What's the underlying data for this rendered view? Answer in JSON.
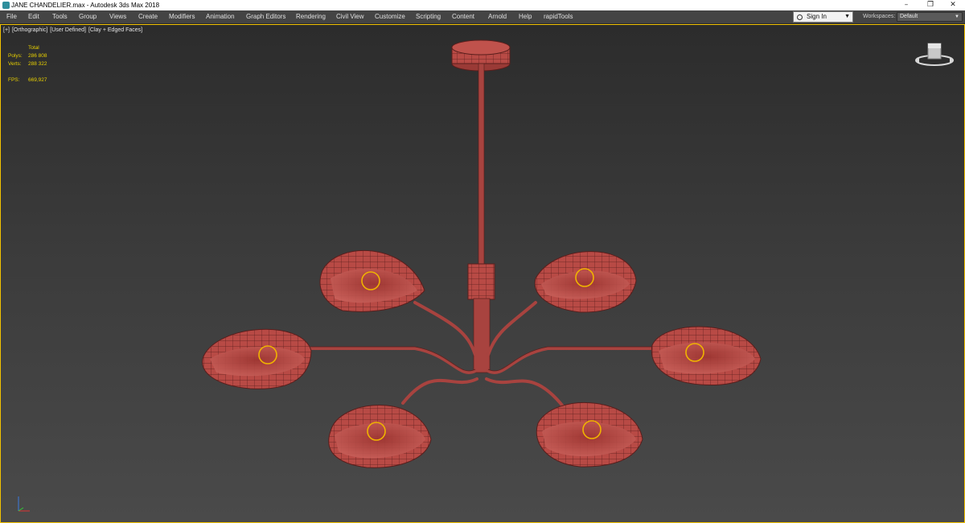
{
  "titlebar": {
    "title": "JANE CHANDELIER.max - Autodesk 3ds Max 2018",
    "app_icon": "3ds-max-icon",
    "controls": {
      "minimize": "–",
      "restore": "❐",
      "close": "✕"
    }
  },
  "menu": {
    "items": [
      "File",
      "Edit",
      "Tools",
      "Group",
      "Views",
      "Create",
      "Modifiers",
      "Animation",
      "Graph Editors",
      "Rendering",
      "Civil View",
      "Customize",
      "Scripting",
      "Content",
      "Arnold",
      "Help",
      "rapidTools"
    ],
    "signin_label": "Sign In",
    "workspaces_label": "Workspaces:",
    "workspaces_value": "Default"
  },
  "viewport": {
    "labels": [
      "[+]",
      "[Orthographic]",
      "[User Defined]",
      "[Clay + Edged Faces]"
    ],
    "stats": {
      "header": "Total",
      "polys_label": "Polys:",
      "polys_value": "286 808",
      "verts_label": "Verts:",
      "verts_value": "288 322",
      "fps_label": "FPS:",
      "fps_value": "669,927"
    },
    "border_color": "#f2c200",
    "model_color": "#b84a45"
  }
}
